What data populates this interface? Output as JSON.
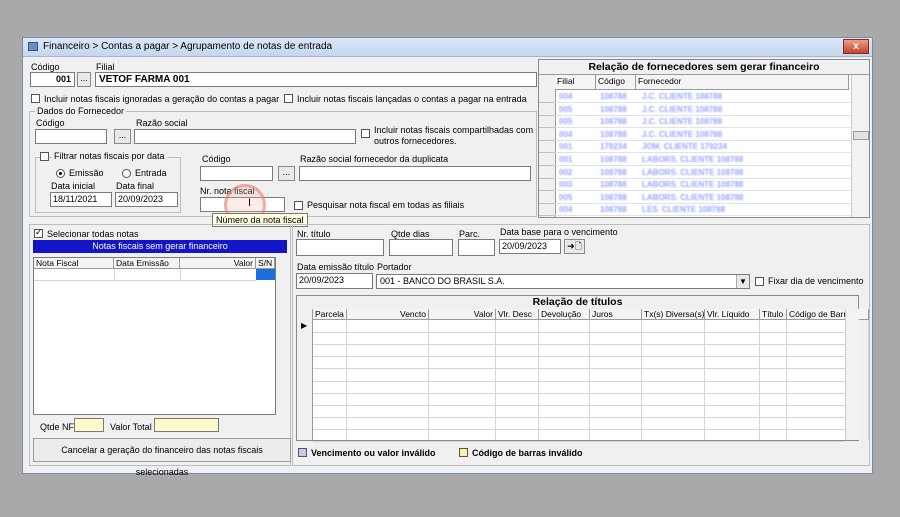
{
  "window": {
    "title": "Financeiro > Contas a pagar > Agrupamento de notas de entrada",
    "close_label": "x"
  },
  "top": {
    "codigo_label": "Código",
    "codigo_value": "001",
    "filial_label": "Filial",
    "filial_value": "VETOF FARMA 001",
    "lookup_label": "...",
    "chk_ignoradas_label": "Incluir notas fiscais ignoradas a geração do contas a pagar",
    "chk_lancadas_label": "Incluir notas fiscais lançadas o contas a pagar na entrada"
  },
  "fornecedor": {
    "group_label": "Dados do Fornecedor",
    "codigo_label": "Código",
    "razao_label": "Razão social",
    "chk_compartilhadas_label": "Incluir notas fiscais compartilhadas com outros fornecedores.",
    "filtrar_label": "Filtrar notas fiscais por data",
    "emissao_label": "Emissão",
    "entrada_label": "Entrada",
    "data_inicial_label": "Data inicial",
    "data_inicial_value": "18/11/2021",
    "data_final_label": "Data final",
    "data_final_value": "20/09/2023",
    "codigo2_label": "Código",
    "razao_dup_label": "Razão social fornecedor da duplicata",
    "nr_nota_label": "Nr. nota fiscal",
    "tooltip": "Número da nota fiscal",
    "pesquisar_label": "Pesquisar nota fiscal em todas as filiais"
  },
  "relacao_fornecedores": {
    "title": "Relação de fornecedores sem gerar financeiro",
    "headers": [
      "Filial",
      "Código",
      "Fornecedor"
    ],
    "rows": [
      [
        "004",
        "108788",
        "J.C. CLIENTE 108788"
      ],
      [
        "005",
        "108788",
        "J.C. CLIENTE 108788"
      ],
      [
        "005",
        "108788",
        "J.C. CLIENTE 108788"
      ],
      [
        "004",
        "108788",
        "J.C. CLIENTE 108788"
      ],
      [
        "001",
        "179234",
        "JOM. CLIENTE 179234"
      ],
      [
        "001",
        "108788",
        "LABORS. CLIENTE 108788"
      ],
      [
        "002",
        "108788",
        "LABORS. CLIENTE 108788"
      ],
      [
        "003",
        "108788",
        "LABORS. CLIENTE 108788"
      ],
      [
        "005",
        "108788",
        "LABORS. CLIENTE 108788"
      ],
      [
        "004",
        "108788",
        "LES. CLIENTE 108788"
      ]
    ]
  },
  "notas": {
    "selecionar_label": "Selecionar todas notas",
    "title": "Notas fiscais sem gerar financeiro",
    "headers": [
      "Nota Fiscal",
      "Data Emissão",
      "Valor",
      "S/N"
    ],
    "qtde_nf_label": "Qtde NF",
    "valor_total_label": "Valor Total",
    "cancelar_label": "Cancelar a geração do financeiro das notas fiscais selecionadas"
  },
  "titulos": {
    "nr_titulo_label": "Nr. título",
    "qtde_dias_label": "Qtde dias",
    "parc_label": "Parc.",
    "data_base_label": "Data base para o vencimento",
    "data_base_value": "20/09/2023",
    "apply_label": "➜🗋",
    "data_emissao_label": "Data emissão título",
    "data_emissao_value": "20/09/2023",
    "portador_label": "Portador",
    "portador_value": "001 - BANCO DO BRASIL S.A.",
    "fixar_label": "Fixar dia de vencimento",
    "relacao_title": "Relação de títulos",
    "headers": [
      "Parcela",
      "Vencto",
      "Valor",
      "Vlr. Desc",
      "Devolução",
      "Juros",
      "Tx(s) Diversa(s)",
      "Vlr. Líquido",
      "Título",
      "Código de Barras"
    ]
  },
  "legend": {
    "invalid_vencimento": "Vencimento ou valor inválido",
    "invalid_barras": "Código de barras inválido",
    "color_vencimento": "#c8c8f0",
    "color_barras": "#fff0a0"
  }
}
